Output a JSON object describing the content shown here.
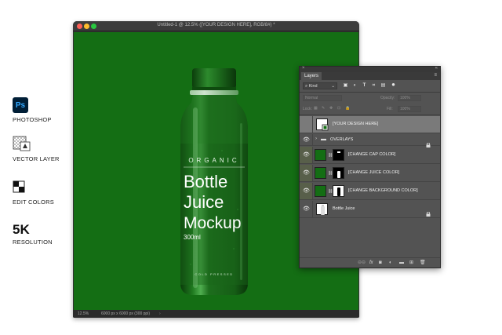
{
  "features": [
    {
      "label": "PHOTOSHOP",
      "icon": "photoshop-icon",
      "badge": "Ps"
    },
    {
      "label": "VECTOR LAYER",
      "icon": "vector-layer-icon"
    },
    {
      "label": "EDIT COLORS",
      "icon": "edit-colors-icon"
    },
    {
      "label": "RESOLUTION",
      "big": "5K",
      "icon": ""
    }
  ],
  "window": {
    "title": "Untitled-1 @ 12.5% ([YOUR DESIGN HERE], RGB/8#) *",
    "zoom": "12.5%",
    "doc_info": "6000 px x 6000 px (300 ppi)",
    "canvas_color": "#146e14"
  },
  "bottle": {
    "top_label": "ORGANIC",
    "line1": "Bottle",
    "line2": "Juice",
    "line3": "Mockup",
    "volume": "300ml",
    "bottom_label": "COLD PRESSED"
  },
  "layers_panel": {
    "close": "×",
    "collapse": "«",
    "tab": "Layers",
    "filter_kind": "Kind",
    "blend_mode": "Normal",
    "opacity_label": "Opacity:",
    "opacity_value": "100%",
    "lock_label": "Lock:",
    "fill_label": "Fill:",
    "fill_value": "100%",
    "layers": [
      {
        "name": "[YOUR DESIGN HERE]",
        "selected": true,
        "locked": false
      },
      {
        "name": "OVERLAYS",
        "selected": false,
        "locked": true
      },
      {
        "name": "[CHANGE CAP COLOR]",
        "selected": false,
        "locked": false
      },
      {
        "name": "[CHANGE JUICE COLOR]",
        "selected": false,
        "locked": false
      },
      {
        "name": "[CHANGE BACKGROUND COLOR]",
        "selected": false,
        "locked": false
      },
      {
        "name": "Bottle Juice",
        "selected": false,
        "locked": true
      }
    ]
  },
  "colors": {
    "accent_green": "#146e14",
    "panel_bg": "#535353",
    "selected_row": "#7a7a7a"
  }
}
